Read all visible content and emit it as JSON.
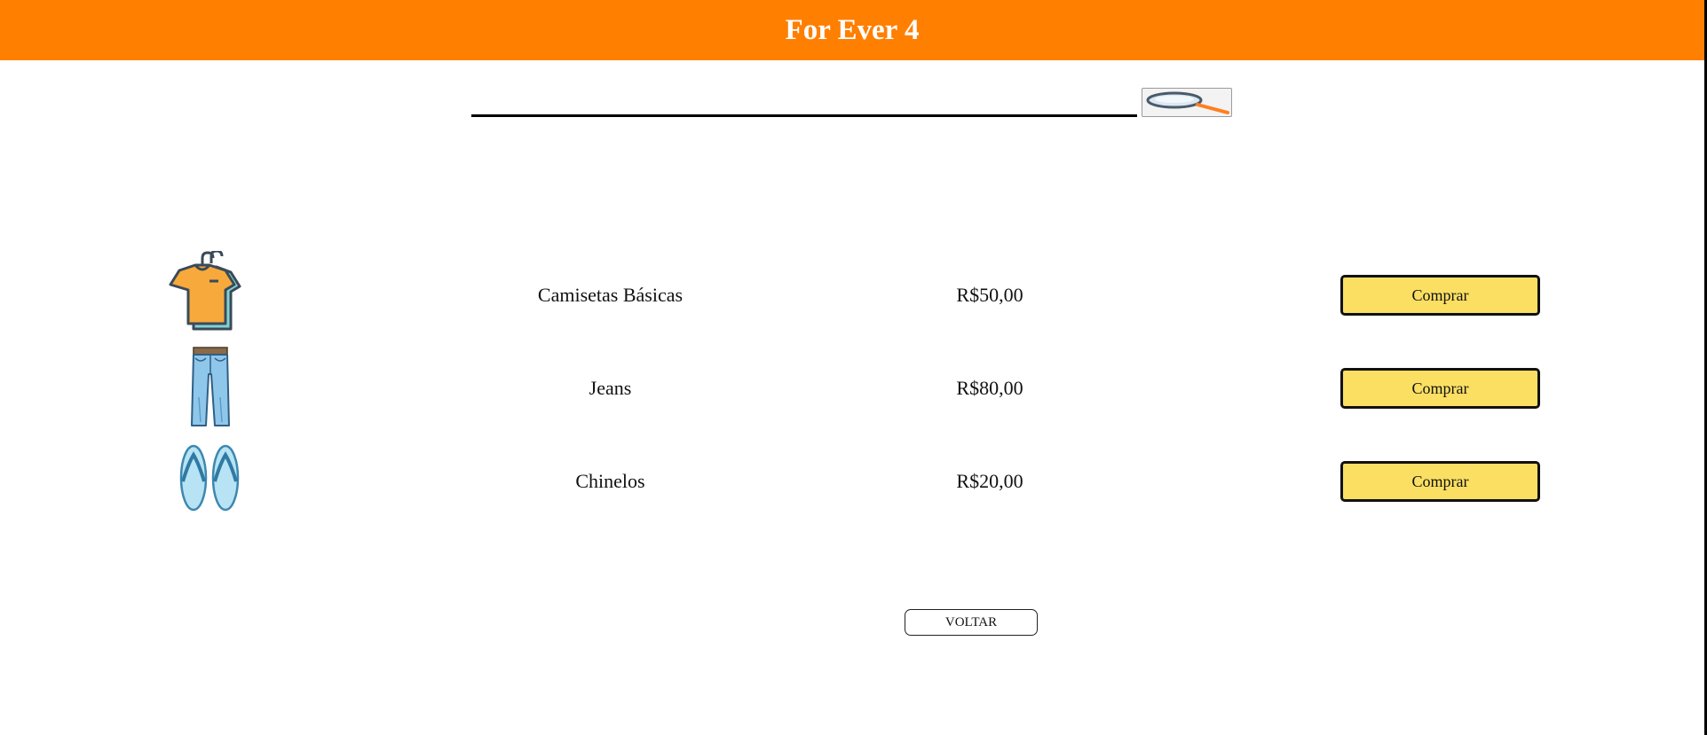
{
  "header": {
    "title": "For Ever 4"
  },
  "search": {
    "placeholder": "",
    "value": "",
    "icon": "magnifier-icon"
  },
  "products": [
    {
      "name": "Camisetas Básicas",
      "price": "R$50,00",
      "button": "Comprar",
      "icon": "tshirt-icon"
    },
    {
      "name": "Jeans",
      "price": "R$80,00",
      "button": "Comprar",
      "icon": "jeans-icon"
    },
    {
      "name": "Chinelos",
      "price": "R$20,00",
      "button": "Comprar",
      "icon": "flip-flops-icon"
    }
  ],
  "footer": {
    "back_label": "VOLTAR"
  },
  "colors": {
    "header": "#ff7f00",
    "buy_button": "#fadf63"
  }
}
